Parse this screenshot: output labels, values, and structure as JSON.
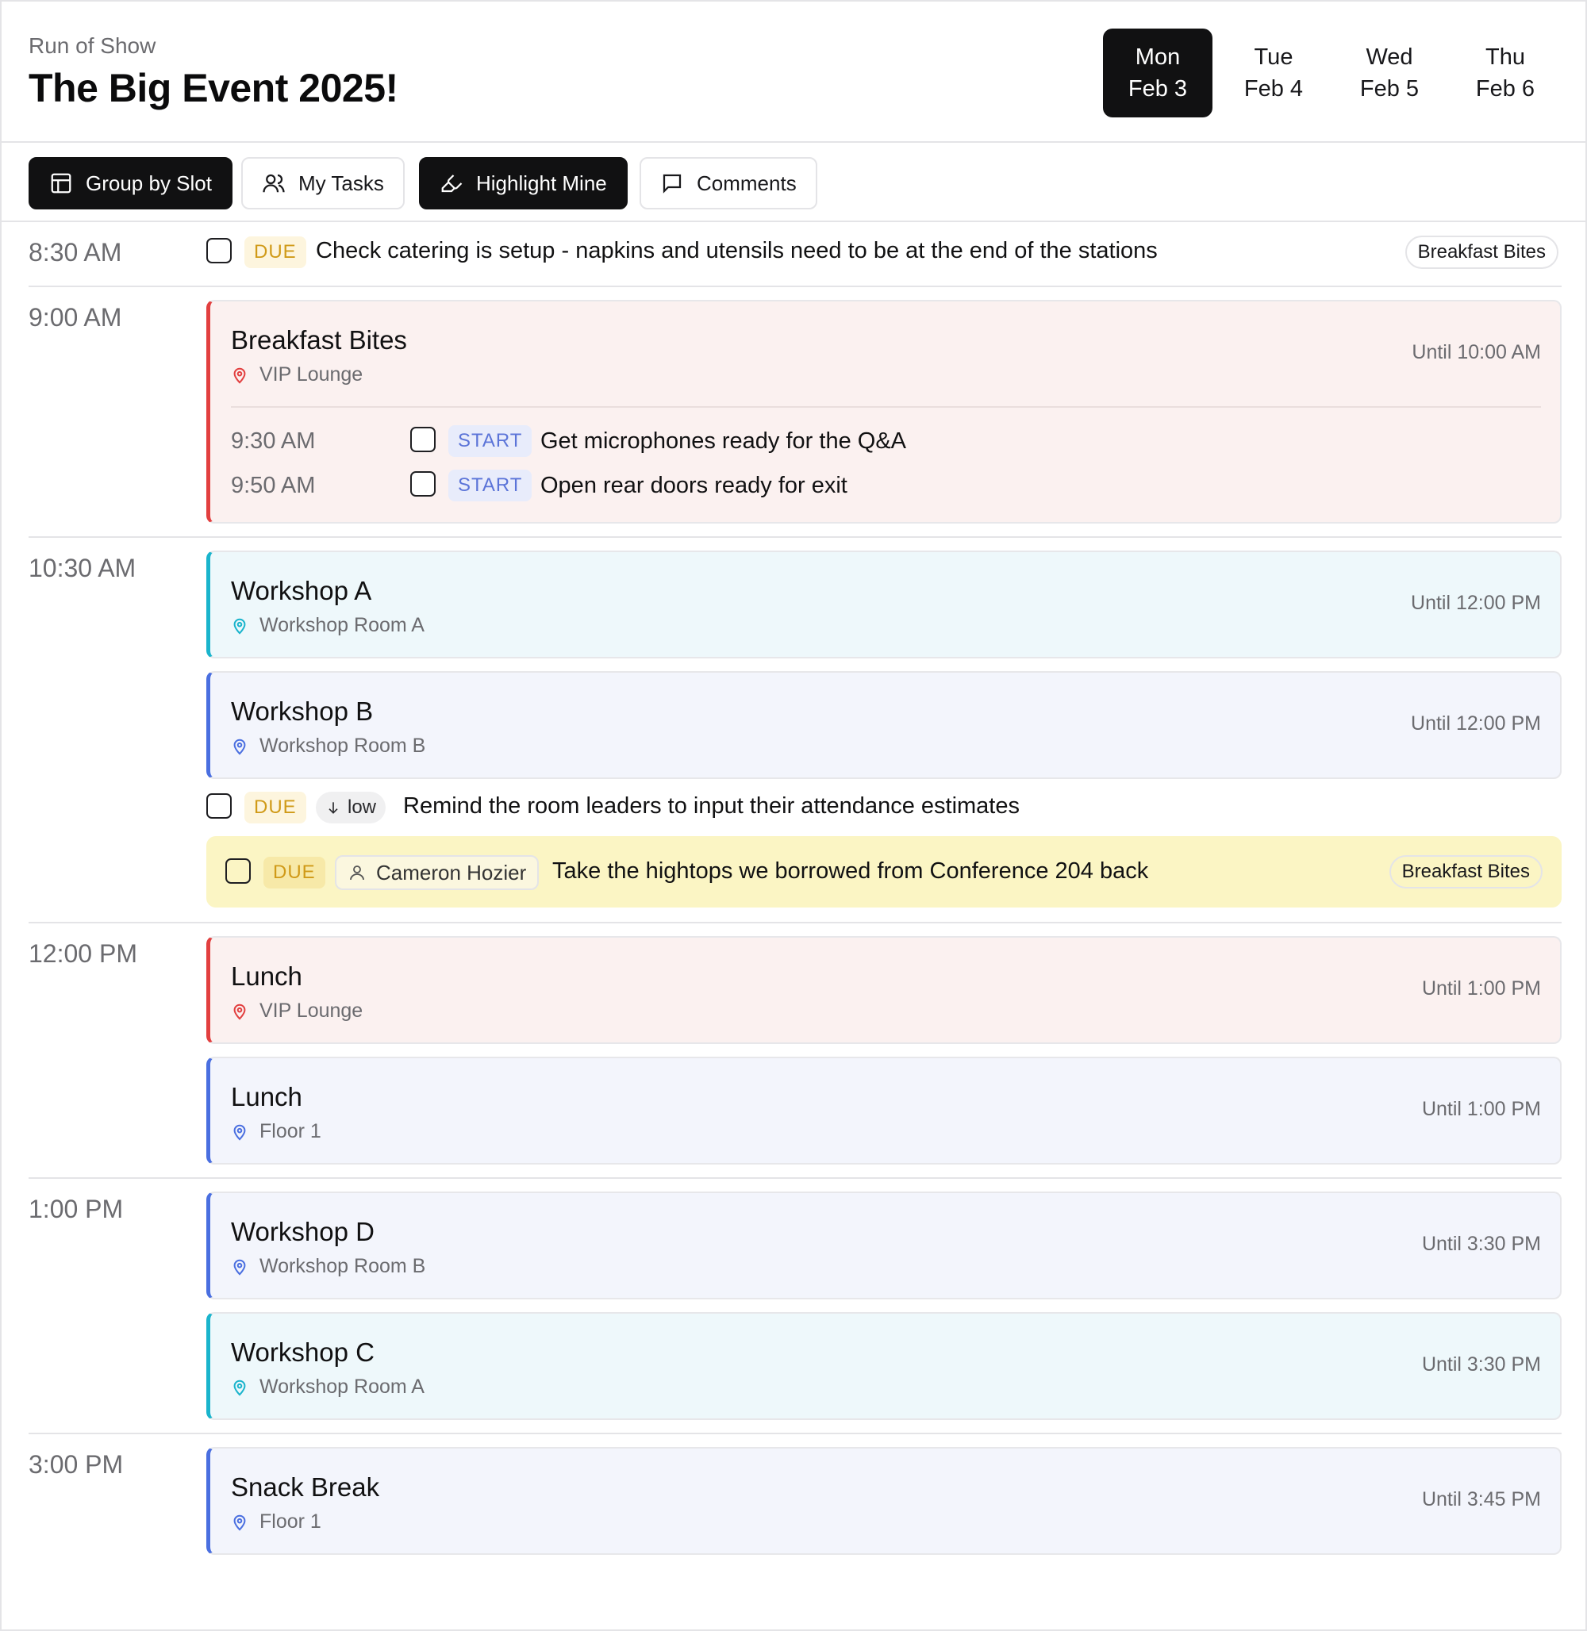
{
  "header": {
    "subtitle": "Run of Show",
    "title": "The Big Event 2025!",
    "days": [
      {
        "dow": "Mon",
        "date": "Feb 3",
        "active": true
      },
      {
        "dow": "Tue",
        "date": "Feb 4",
        "active": false
      },
      {
        "dow": "Wed",
        "date": "Feb 5",
        "active": false
      },
      {
        "dow": "Thu",
        "date": "Feb 6",
        "active": false
      }
    ]
  },
  "toolbar": {
    "group_by_slot": "Group by Slot",
    "my_tasks": "My Tasks",
    "highlight_mine": "Highlight Mine",
    "comments": "Comments"
  },
  "slots": {
    "s1": {
      "time": "8:30 AM",
      "task": {
        "tag": "DUE",
        "text": "Check catering is setup - napkins and utensils need to be at the end of the stations",
        "pill": "Breakfast Bites"
      }
    },
    "s2": {
      "time": "9:00 AM",
      "card": {
        "title": "Breakfast Bites",
        "location": "VIP Lounge",
        "until": "Until 10:00 AM"
      },
      "subtasks": [
        {
          "time": "9:30 AM",
          "tag": "START",
          "text": "Get microphones ready for the Q&A"
        },
        {
          "time": "9:50 AM",
          "tag": "START",
          "text": "Open rear doors ready for exit"
        }
      ]
    },
    "s3": {
      "time": "10:30 AM",
      "cards": [
        {
          "title": "Workshop A",
          "location": "Workshop Room A",
          "until": "Until 12:00 PM"
        },
        {
          "title": "Workshop B",
          "location": "Workshop Room B",
          "until": "Until 12:00 PM"
        }
      ],
      "task1": {
        "tag": "DUE",
        "priority": "low",
        "text": "Remind the room leaders to input their attendance estimates"
      },
      "task2": {
        "tag": "DUE",
        "assignee": "Cameron Hozier",
        "text": "Take the hightops we borrowed from Conference 204 back",
        "pill": "Breakfast Bites"
      }
    },
    "s4": {
      "time": "12:00 PM",
      "cards": [
        {
          "title": "Lunch",
          "location": "VIP Lounge",
          "until": "Until 1:00 PM"
        },
        {
          "title": "Lunch",
          "location": "Floor 1",
          "until": "Until 1:00 PM"
        }
      ]
    },
    "s5": {
      "time": "1:00 PM",
      "cards": [
        {
          "title": "Workshop D",
          "location": "Workshop Room B",
          "until": "Until 3:30 PM"
        },
        {
          "title": "Workshop C",
          "location": "Workshop Room A",
          "until": "Until 3:30 PM"
        }
      ]
    },
    "s6": {
      "time": "3:00 PM",
      "card": {
        "title": "Snack Break",
        "location": "Floor 1",
        "until": "Until 3:45 PM"
      }
    }
  },
  "colors": {
    "accent_dark": "#111112",
    "red_stripe": "#e23f3f",
    "teal_stripe": "#1ab4cc",
    "blue_stripe": "#4a6fe0",
    "due_tag": "#d09a18",
    "start_tag": "#5b74d8",
    "highlight": "#fbf5c4"
  }
}
